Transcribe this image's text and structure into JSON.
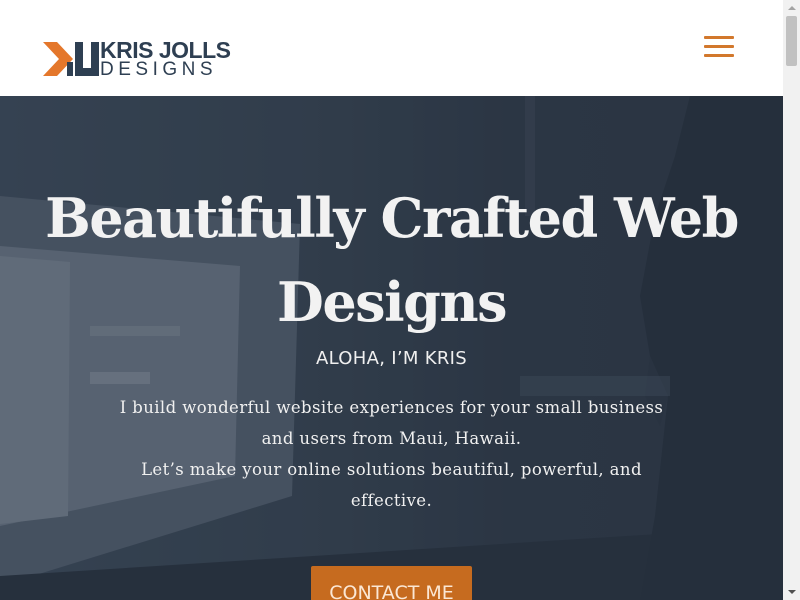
{
  "logo": {
    "line1": "KRIS JOLLS",
    "line2": "DESIGNS",
    "icon": "kj-monogram-icon",
    "colors": {
      "orange": "#E4772B",
      "navy": "#2E3F52"
    }
  },
  "header": {
    "menu_icon": "hamburger-menu-icon",
    "menu_color": "#D2782C"
  },
  "hero": {
    "title": "Beautifully Crafted Web Designs",
    "subtitle": "ALOHA, I’M KRIS",
    "text_line1": "I build wonderful website experiences for your small business",
    "text_line2": "and users from Maui, Hawaii.",
    "text_line3": "Let’s make your online solutions beautiful, powerful, and",
    "text_line4": "effective.",
    "cta_label": "CONTACT ME",
    "cta_color": "#C66B1F",
    "background_image": "man-working-at-computer-photo"
  },
  "scrollbar": {
    "up_icon": "scroll-up-arrow-icon",
    "down_icon": "scroll-down-arrow-icon"
  }
}
